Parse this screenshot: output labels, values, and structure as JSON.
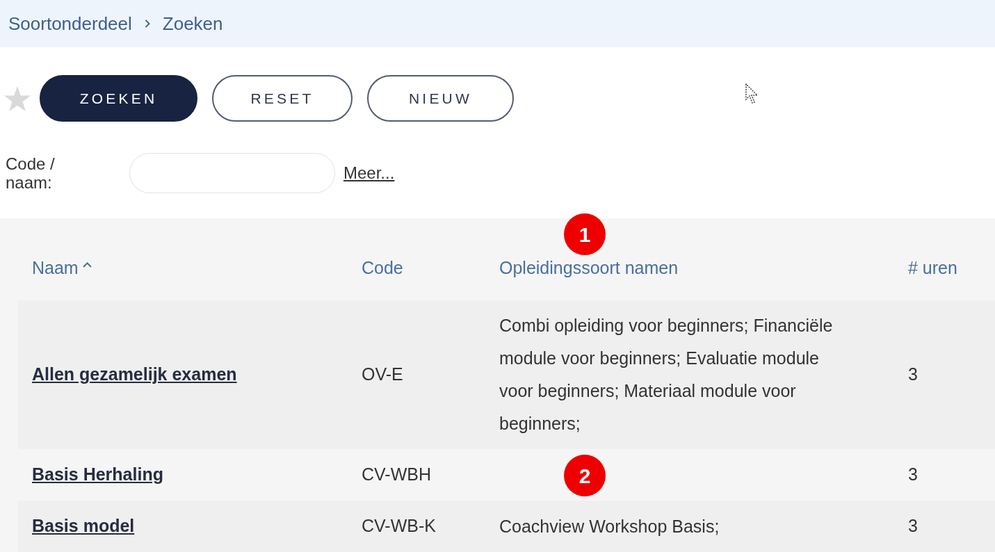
{
  "breadcrumb": [
    {
      "label": "Soortonderdeel"
    },
    {
      "label": "Zoeken"
    }
  ],
  "favorite": {
    "starred": false
  },
  "buttons": [
    {
      "label": "ZOEKEN",
      "kind": "primary"
    },
    {
      "label": "RESET",
      "kind": "outline"
    },
    {
      "label": "NIEUW",
      "kind": "outline"
    }
  ],
  "search": {
    "label": "Code / naam:",
    "more_link": "Meer..."
  },
  "table": {
    "columns": [
      {
        "label": "Naam",
        "sorted": true
      },
      {
        "label": "Code",
        "sorted": false
      },
      {
        "label": "Opleidingssoort namen",
        "sorted": false
      },
      {
        "label": "# uren",
        "sorted": false
      }
    ],
    "rows": [
      {
        "name": "Allen gezamelijk examen",
        "code": "OV-E",
        "course_types": "Combi opleiding voor beginners; Financiële module voor beginners; Evaluatie module voor beginners; Materiaal module voor beginners;",
        "hours": "3"
      },
      {
        "name": "Basis Herhaling",
        "code": "CV-WBH",
        "hours": "3"
      },
      {
        "name": "Basis model",
        "code": "CV-WB-K",
        "course_types": "Coachview Workshop Basis;",
        "hours": "3"
      }
    ]
  },
  "annotations": [
    {
      "label": "1"
    },
    {
      "label": "2"
    }
  ]
}
